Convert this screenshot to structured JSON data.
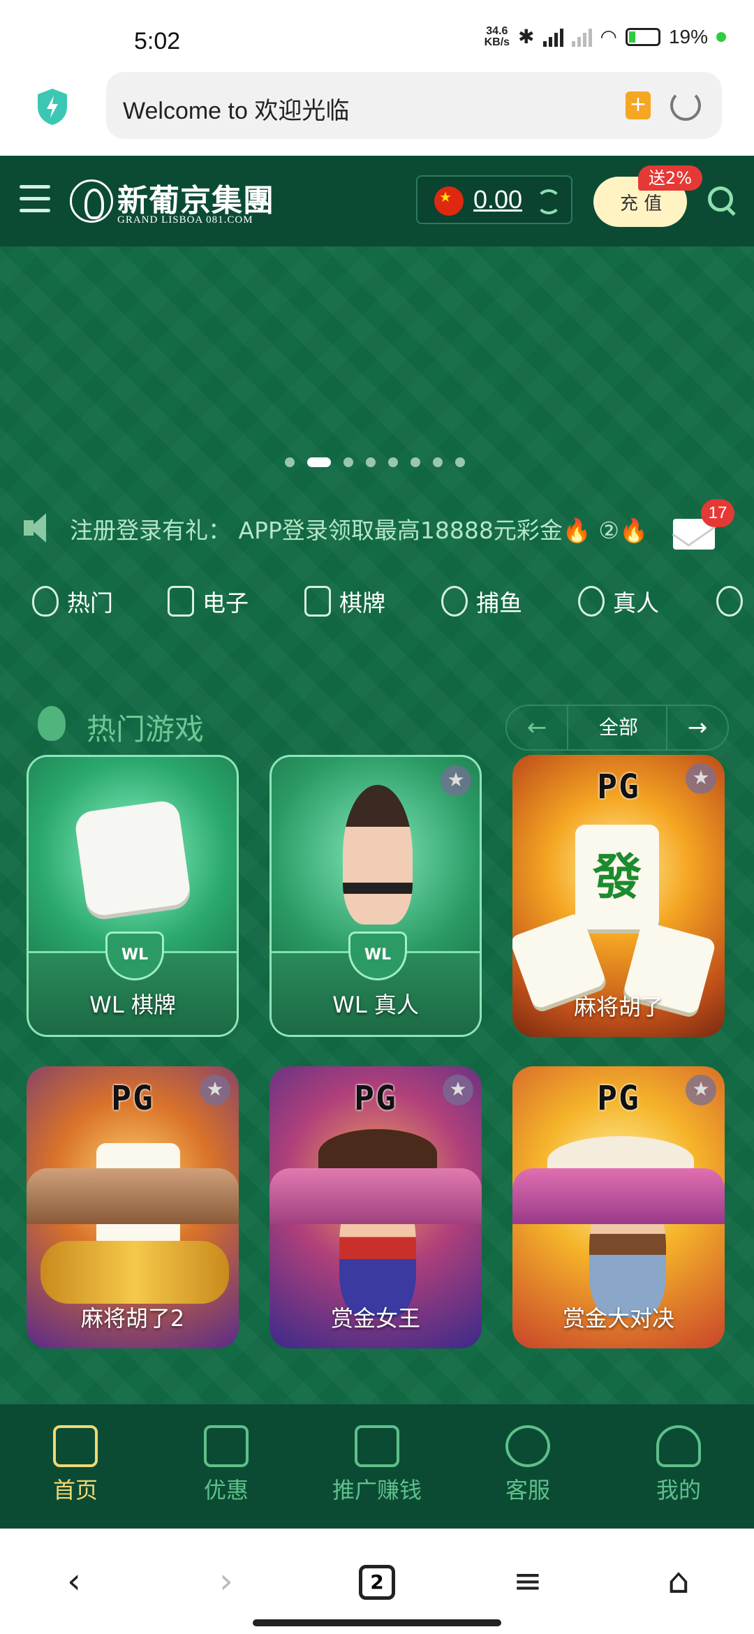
{
  "status_bar": {
    "time": "5:02",
    "net_speed_value": "34.6",
    "net_speed_unit": "KB/s",
    "battery": "19%"
  },
  "browser": {
    "url_text": "Welcome to 欢迎光临",
    "bookmark_icon": "bookmark-icon",
    "tab_count": "2"
  },
  "header": {
    "logo_cn": "新葡京集團",
    "logo_en": "GRAND LISBOA 081.COM",
    "balance": "0.00",
    "deposit_label": "充 值",
    "deposit_bonus": "送2%"
  },
  "banner": {
    "slides": 8,
    "active_index": 1
  },
  "marquee": {
    "text": "注册登录有礼： APP登录领取最高18888元彩金🔥 ②🔥",
    "mail_badge": "17"
  },
  "categories": [
    {
      "label": "热门",
      "icon": "fire-icon"
    },
    {
      "label": "电子",
      "icon": "slot-machine-icon"
    },
    {
      "label": "棋牌",
      "icon": "cards-icon"
    },
    {
      "label": "捕鱼",
      "icon": "fish-icon"
    },
    {
      "label": "真人",
      "icon": "person-icon"
    }
  ],
  "section": {
    "title": "热门游戏",
    "pager_all": "全部",
    "prev_icon": "arrow-left-icon",
    "next_icon": "arrow-right-icon"
  },
  "games": [
    {
      "label": "WL 棋牌",
      "provider": "WL"
    },
    {
      "label": "WL 真人",
      "provider": "WL"
    },
    {
      "label": "麻将胡了",
      "provider": "PG"
    },
    {
      "label": "麻将胡了2",
      "provider": "PG"
    },
    {
      "label": "赏金女王",
      "provider": "PG"
    },
    {
      "label": "赏金大对决",
      "provider": "PG"
    }
  ],
  "tile_glyph": "發",
  "bottom_nav": [
    {
      "label": "首页",
      "icon": "home-icon",
      "active": true
    },
    {
      "label": "优惠",
      "icon": "gift-icon",
      "active": false
    },
    {
      "label": "推广赚钱",
      "icon": "share-icon",
      "active": false
    },
    {
      "label": "客服",
      "icon": "headset-icon",
      "active": false
    },
    {
      "label": "我的",
      "icon": "user-icon",
      "active": false
    }
  ],
  "colors": {
    "header_bg": "#0b4b34",
    "main_bg": "#126b44",
    "accent_gold": "#f2d874",
    "accent_green": "#5fc08a",
    "badge_red": "#e53935"
  }
}
